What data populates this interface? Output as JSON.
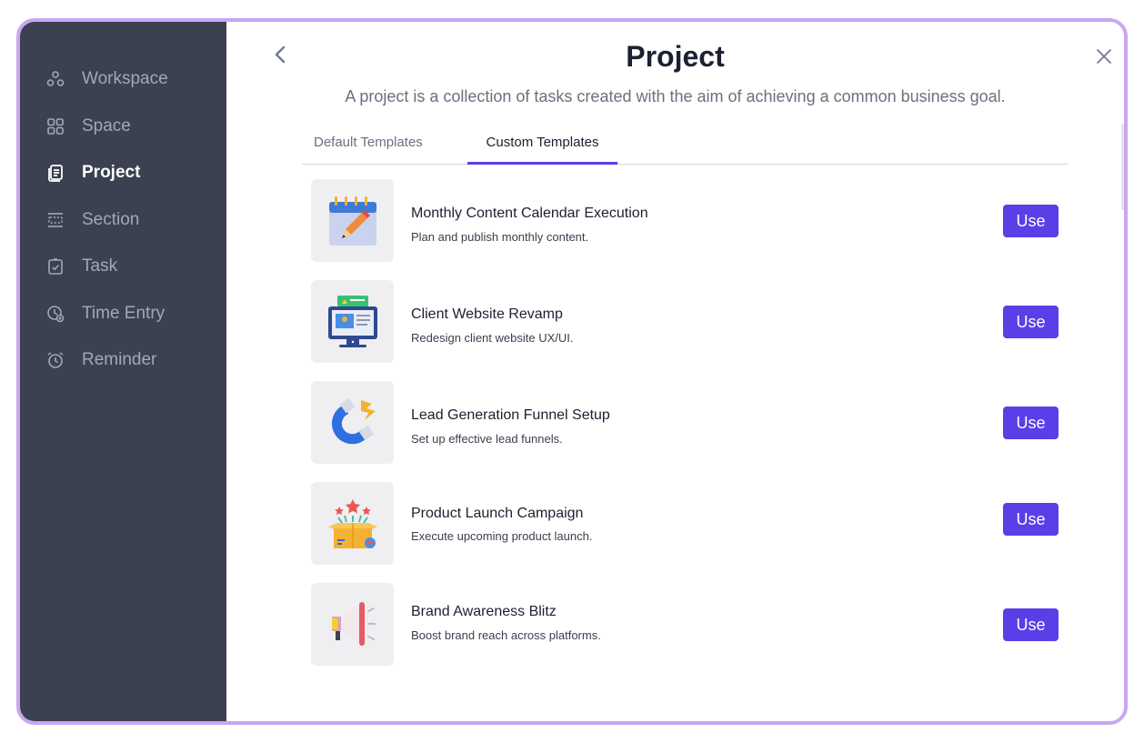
{
  "sidebar": {
    "items": [
      {
        "label": "Workspace",
        "icon": "workspace-icon"
      },
      {
        "label": "Space",
        "icon": "grid-icon"
      },
      {
        "label": "Project",
        "icon": "clipboard-icon",
        "active": true
      },
      {
        "label": "Section",
        "icon": "section-icon"
      },
      {
        "label": "Task",
        "icon": "task-check-icon"
      },
      {
        "label": "Time Entry",
        "icon": "clock-icon"
      },
      {
        "label": "Reminder",
        "icon": "alarm-icon"
      }
    ]
  },
  "header": {
    "title": "Project",
    "subtitle": "A project is a collection of tasks created with the aim of achieving a common business goal."
  },
  "tabs": [
    {
      "label": "Default Templates",
      "active": false
    },
    {
      "label": "Custom Templates",
      "active": true
    }
  ],
  "templates": [
    {
      "name": "Monthly Content Calendar Execution",
      "description": "Plan and publish monthly content.",
      "icon": "calendar-pencil-icon",
      "button": "Use"
    },
    {
      "name": "Client Website Revamp",
      "description": "Redesign client website UX/UI.",
      "icon": "monitor-website-icon",
      "button": "Use"
    },
    {
      "name": "Lead Generation Funnel Setup",
      "description": "Set up effective lead funnels.",
      "icon": "magnet-icon",
      "button": "Use"
    },
    {
      "name": "Product Launch Campaign",
      "description": "Execute upcoming product launch.",
      "icon": "open-box-icon",
      "button": "Use"
    },
    {
      "name": "Brand Awareness Blitz",
      "description": "Boost brand reach across platforms.",
      "icon": "megaphone-icon",
      "button": "Use"
    }
  ],
  "colors": {
    "accent": "#5a3fe8",
    "sidebar_bg": "#3b4150",
    "frame_border": "#c9a6f2"
  }
}
